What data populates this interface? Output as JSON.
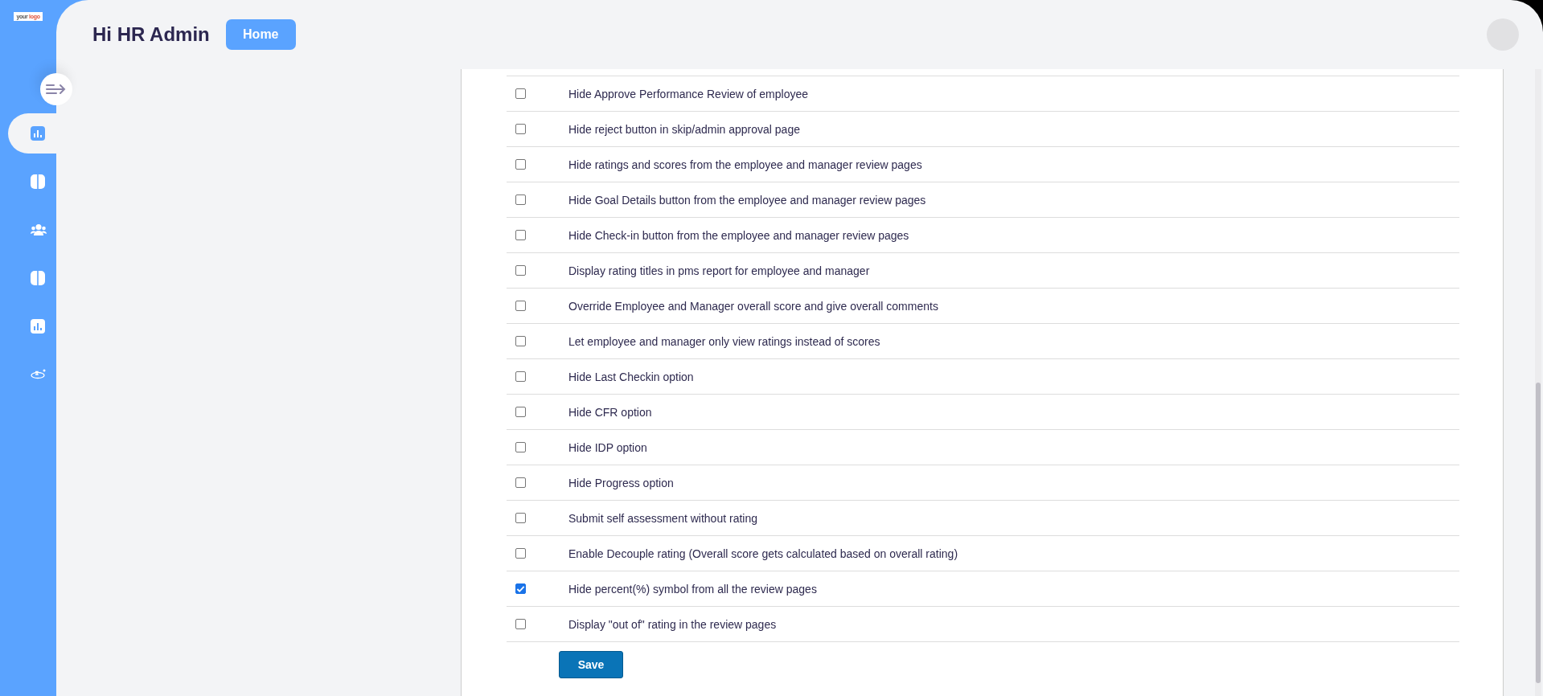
{
  "logo": {
    "text": "your",
    "accent": "logo"
  },
  "sidebar": {
    "items": [
      {
        "kind": "chart",
        "selected": true
      },
      {
        "kind": "panel",
        "selected": false
      },
      {
        "kind": "people",
        "selected": false
      },
      {
        "kind": "panel",
        "selected": false
      },
      {
        "kind": "chart",
        "selected": false
      },
      {
        "kind": "degrees",
        "selected": false
      }
    ]
  },
  "header": {
    "greeting": "Hi HR Admin",
    "home_button": "Home"
  },
  "settings": [
    {
      "label": "Hide Approve Performance Review of employee",
      "checked": false
    },
    {
      "label": "Hide reject button in skip/admin approval page",
      "checked": false
    },
    {
      "label": "Hide ratings and scores from the employee and manager review pages",
      "checked": false
    },
    {
      "label": "Hide Goal Details button from the employee and manager review pages",
      "checked": false
    },
    {
      "label": "Hide Check-in button from the employee and manager review pages",
      "checked": false
    },
    {
      "label": "Display rating titles in pms report for employee and manager",
      "checked": false
    },
    {
      "label": "Override Employee and Manager overall score and give overall comments",
      "checked": false
    },
    {
      "label": "Let employee and manager only view ratings instead of scores",
      "checked": false
    },
    {
      "label": "Hide Last Checkin option",
      "checked": false
    },
    {
      "label": "Hide CFR option",
      "checked": false
    },
    {
      "label": "Hide IDP option",
      "checked": false
    },
    {
      "label": "Hide Progress option",
      "checked": false
    },
    {
      "label": "Submit self assessment without rating",
      "checked": false
    },
    {
      "label": "Enable Decouple rating (Overall score gets calculated based on overall rating)",
      "checked": false
    },
    {
      "label": "Hide percent(%) symbol from all the review pages",
      "checked": true
    },
    {
      "label": "Display \"out of\" rating in the review pages",
      "checked": false
    }
  ],
  "save_button": "Save"
}
